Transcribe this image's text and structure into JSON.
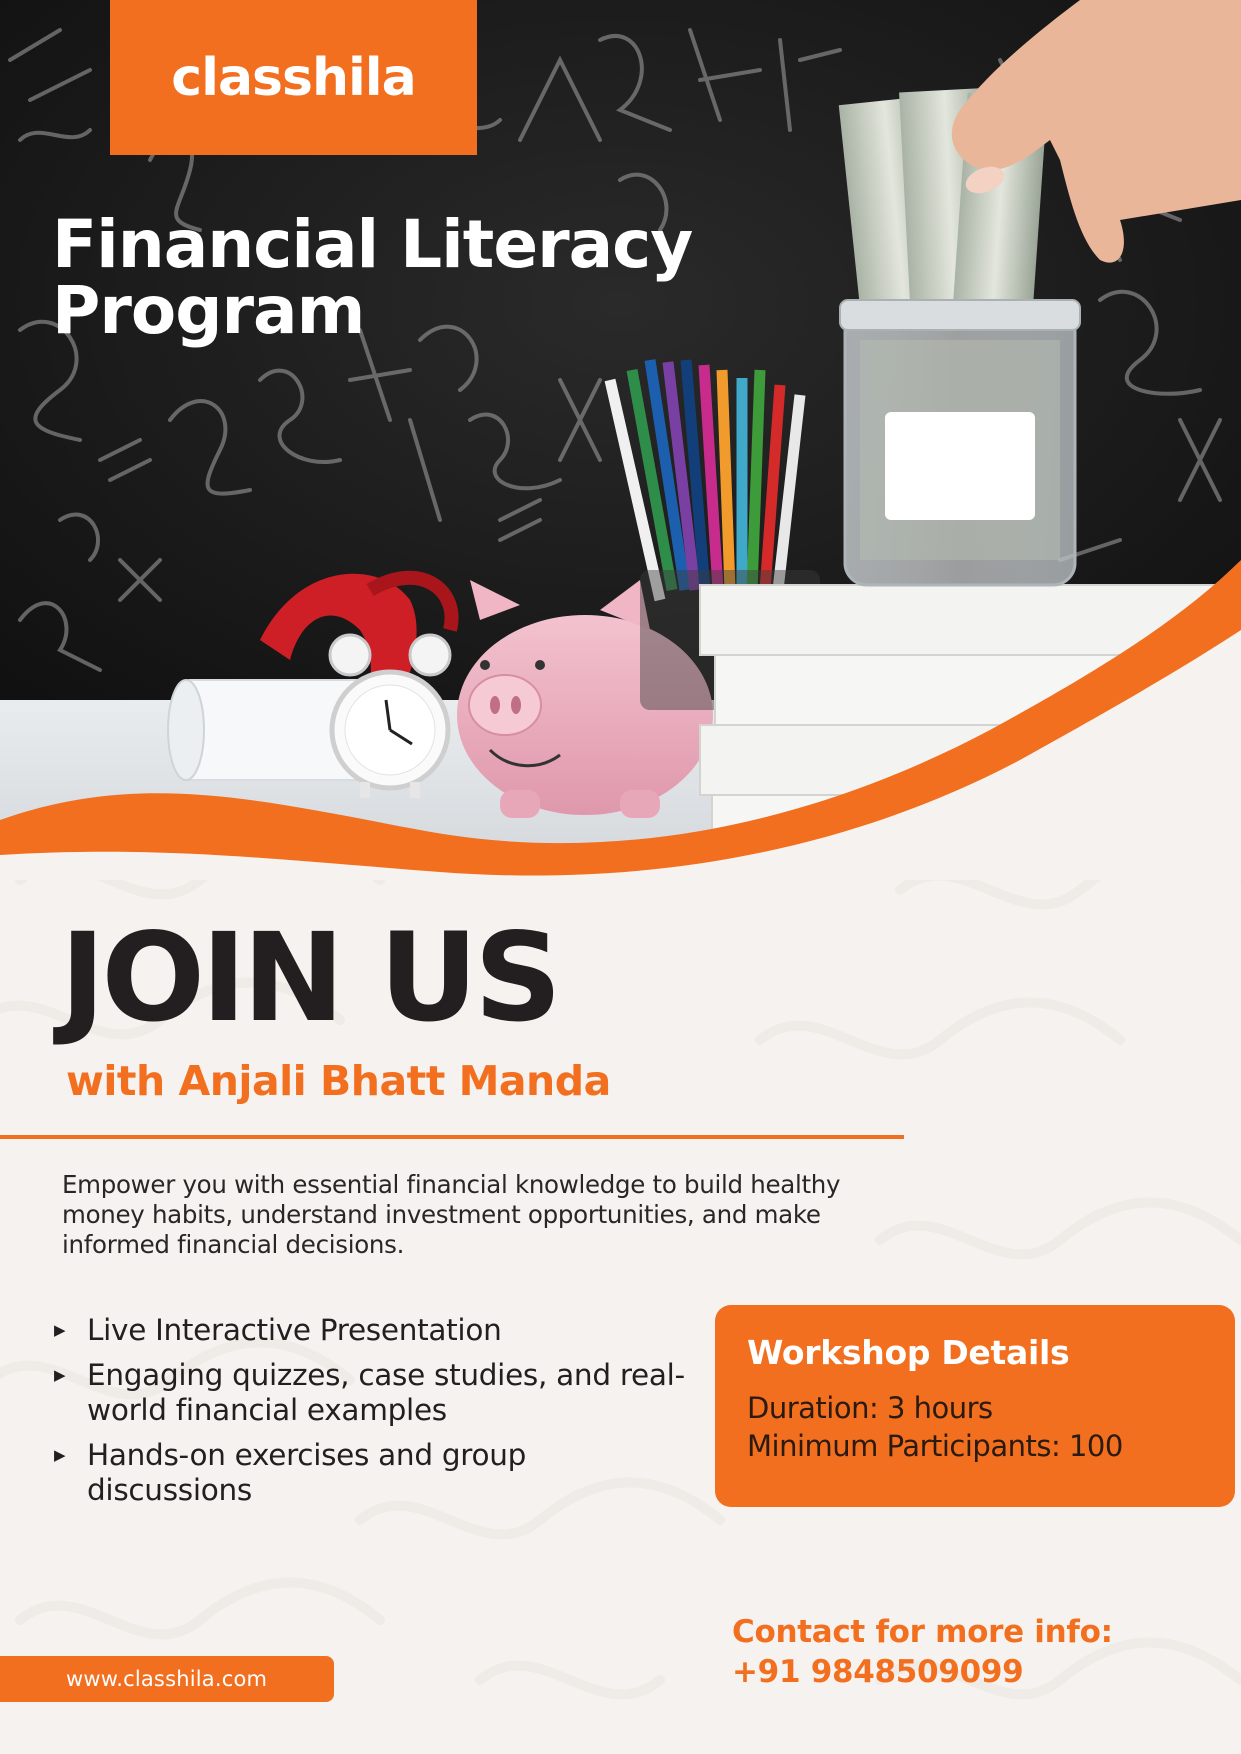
{
  "brand": {
    "logo_text": "classhila",
    "accent_color": "#f26f1f",
    "dark_color": "#231f20"
  },
  "hero": {
    "title_line1": "Financial Literacy",
    "title_line2": "Program",
    "image": "photo-of-chalkboard-piggy-bank-coin-jar-pencils-clock-books"
  },
  "main": {
    "heading": "JOIN US",
    "host": "with Anjali Bhatt Manda",
    "description": "Empower you with essential financial knowledge to build healthy money habits, understand investment opportunities, and make informed financial decisions.",
    "bullets": [
      "Live Interactive Presentation",
      "Engaging quizzes, case studies, and real-world financial examples",
      "Hands-on exercises and group discussions"
    ],
    "bullet_icon": "triangle-right-icon"
  },
  "workshop": {
    "title": "Workshop Details",
    "duration": "Duration: 3 hours",
    "participants": "Minimum Participants: 100"
  },
  "contact": {
    "label": "Contact for more info:",
    "phone": "+91 9848509099"
  },
  "footer": {
    "website": "www.classhila.com"
  }
}
